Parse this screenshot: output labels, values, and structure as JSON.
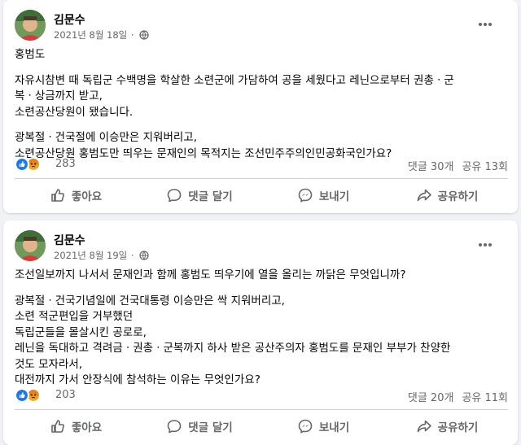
{
  "posts": [
    {
      "author": "김문수",
      "date": "2021년 8월 18일",
      "lines": [
        "홍범도",
        "",
        "자유시참변 때 독립군 수백명을 학살한 소련군에 가담하여 공을 세웠다고 레닌으로부터 권총ㆍ군",
        "복ㆍ상금까지 받고,",
        "소련공산당원이 됐습니다.",
        "",
        "광복절ㆍ건국절에 이승만은 지워버리고,",
        "소련공산당원 홍범도만 띄우는 문재인의 목적지는 조선민주주의인민공화국인가요?"
      ],
      "reaction_count": "283",
      "comments": "댓글 30개",
      "shares": "공유 13회"
    },
    {
      "author": "김문수",
      "date": "2021년 8월 19일",
      "lines": [
        "조선일보까지 나서서 문재인과 함께  홍범도 띄우기에 열을 올리는 까닭은 무엇입니까?",
        "",
        "광복절ㆍ건국기념일에 건국대통령 이승만은 싹 지워버리고,",
        "소련 적군편입을 거부했던",
        "독립군들을 몰살시킨  공로로,",
        "레닌을 독대하고 격려금ㆍ권총ㆍ군복까지 하사 받은 공산주의자 홍범도를 문재인 부부가 찬양한",
        "것도 모자라서,",
        "대전까지 가서 안장식에 참석하는 이유는 무엇인가요?"
      ],
      "reaction_count": "203",
      "comments": "댓글 20개",
      "shares": "공유 11회"
    }
  ],
  "actions": {
    "like": "좋아요",
    "comment": "댓글 달기",
    "send": "보내기",
    "share": "공유하기"
  },
  "colors": {
    "like_blue": "#1877f2",
    "angry_orange": "#e9710f",
    "secondary_text": "#65676b"
  },
  "icons": [
    "globe-icon",
    "more-options-icon",
    "like-reaction-icon",
    "angry-reaction-icon",
    "thumbs-up-icon",
    "comment-icon",
    "messenger-icon",
    "share-icon"
  ]
}
